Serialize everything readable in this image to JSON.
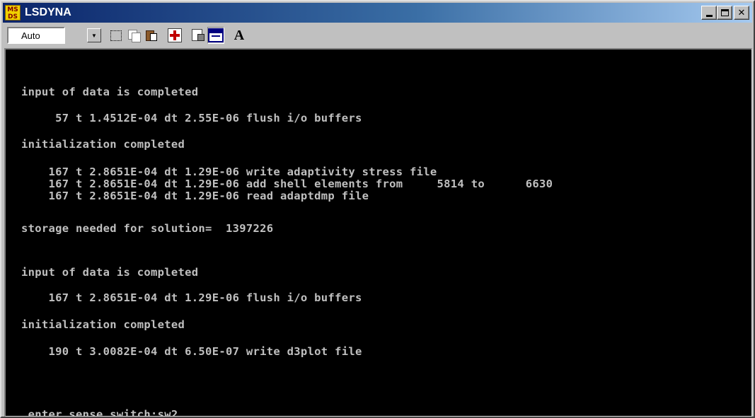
{
  "window": {
    "title": "LSDYNA",
    "icon_label_top": "MS",
    "icon_label_bottom": "DS",
    "controls": [
      "minimize",
      "maximize",
      "close"
    ]
  },
  "toolbar": {
    "font_size_value": "Auto",
    "buttons": [
      {
        "name": "mark-icon"
      },
      {
        "name": "copy-icon"
      },
      {
        "name": "paste-icon"
      },
      {
        "name": "full-screen-icon"
      },
      {
        "name": "properties-icon"
      },
      {
        "name": "background-icon"
      },
      {
        "name": "font-icon",
        "glyph": "A"
      }
    ]
  },
  "console": {
    "lines": [
      "input of data is completed",
      "     57 t 1.4512E-04 dt 2.55E-06 flush i/o buffers",
      "initialization completed",
      "    167 t 2.8651E-04 dt 1.29E-06 write adaptivity stress file",
      "    167 t 2.8651E-04 dt 1.29E-06 add shell elements from     5814 to      6630",
      "    167 t 2.8651E-04 dt 1.29E-06 read adaptdmp file",
      "storage needed for solution=  1397226",
      "input of data is completed",
      "    167 t 2.8651E-04 dt 1.29E-06 flush i/o buffers",
      "initialization completed",
      "    190 t 3.0082E-04 dt 6.50E-07 write d3plot file",
      ".enter sense switch:sw2"
    ]
  }
}
